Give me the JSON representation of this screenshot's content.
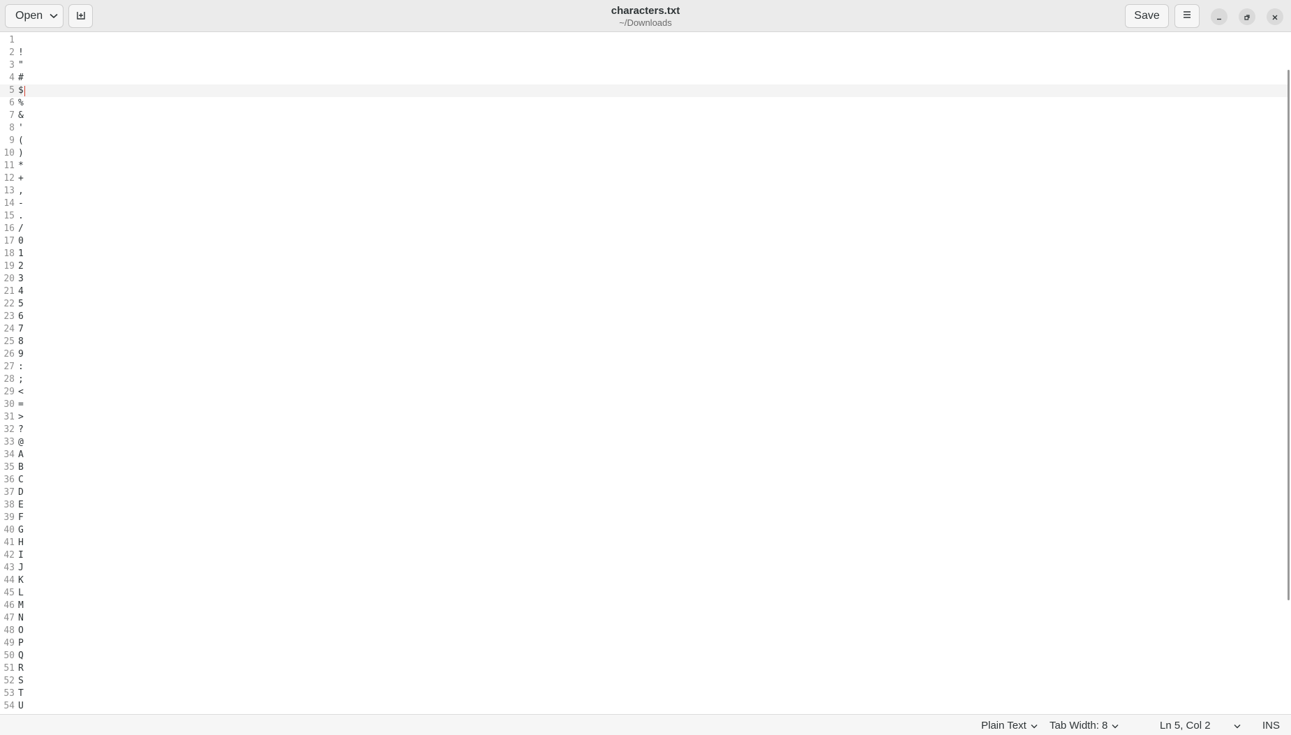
{
  "header": {
    "open_label": "Open",
    "save_label": "Save",
    "title": "characters.txt",
    "subtitle": "~/Downloads"
  },
  "editor": {
    "current_line": 5,
    "lines": [
      "",
      "!",
      "\"",
      "#",
      "$",
      "%",
      "&",
      "'",
      "(",
      ")",
      "*",
      "+",
      ",",
      "-",
      ".",
      "/",
      "0",
      "1",
      "2",
      "3",
      "4",
      "5",
      "6",
      "7",
      "8",
      "9",
      ":",
      ";",
      "<",
      "=",
      ">",
      "?",
      "@",
      "A",
      "B",
      "C",
      "D",
      "E",
      "F",
      "G",
      "H",
      "I",
      "J",
      "K",
      "L",
      "M",
      "N",
      "O",
      "P",
      "Q",
      "R",
      "S",
      "T",
      "U"
    ]
  },
  "statusbar": {
    "language": "Plain Text",
    "tab_width": "Tab Width: 8",
    "cursor_position": "Ln 5, Col 2",
    "insert_mode": "INS"
  },
  "icons": {
    "open": "chevron-down-icon",
    "new_tab": "new-tab-icon",
    "menu": "hamburger-menu-icon",
    "minimize": "minimize-icon",
    "maximize": "restore-icon",
    "close": "close-icon"
  },
  "colors": {
    "caret": "#d33f2f",
    "header_bg": "#ebebeb",
    "line_number": "#8f8f8f"
  }
}
